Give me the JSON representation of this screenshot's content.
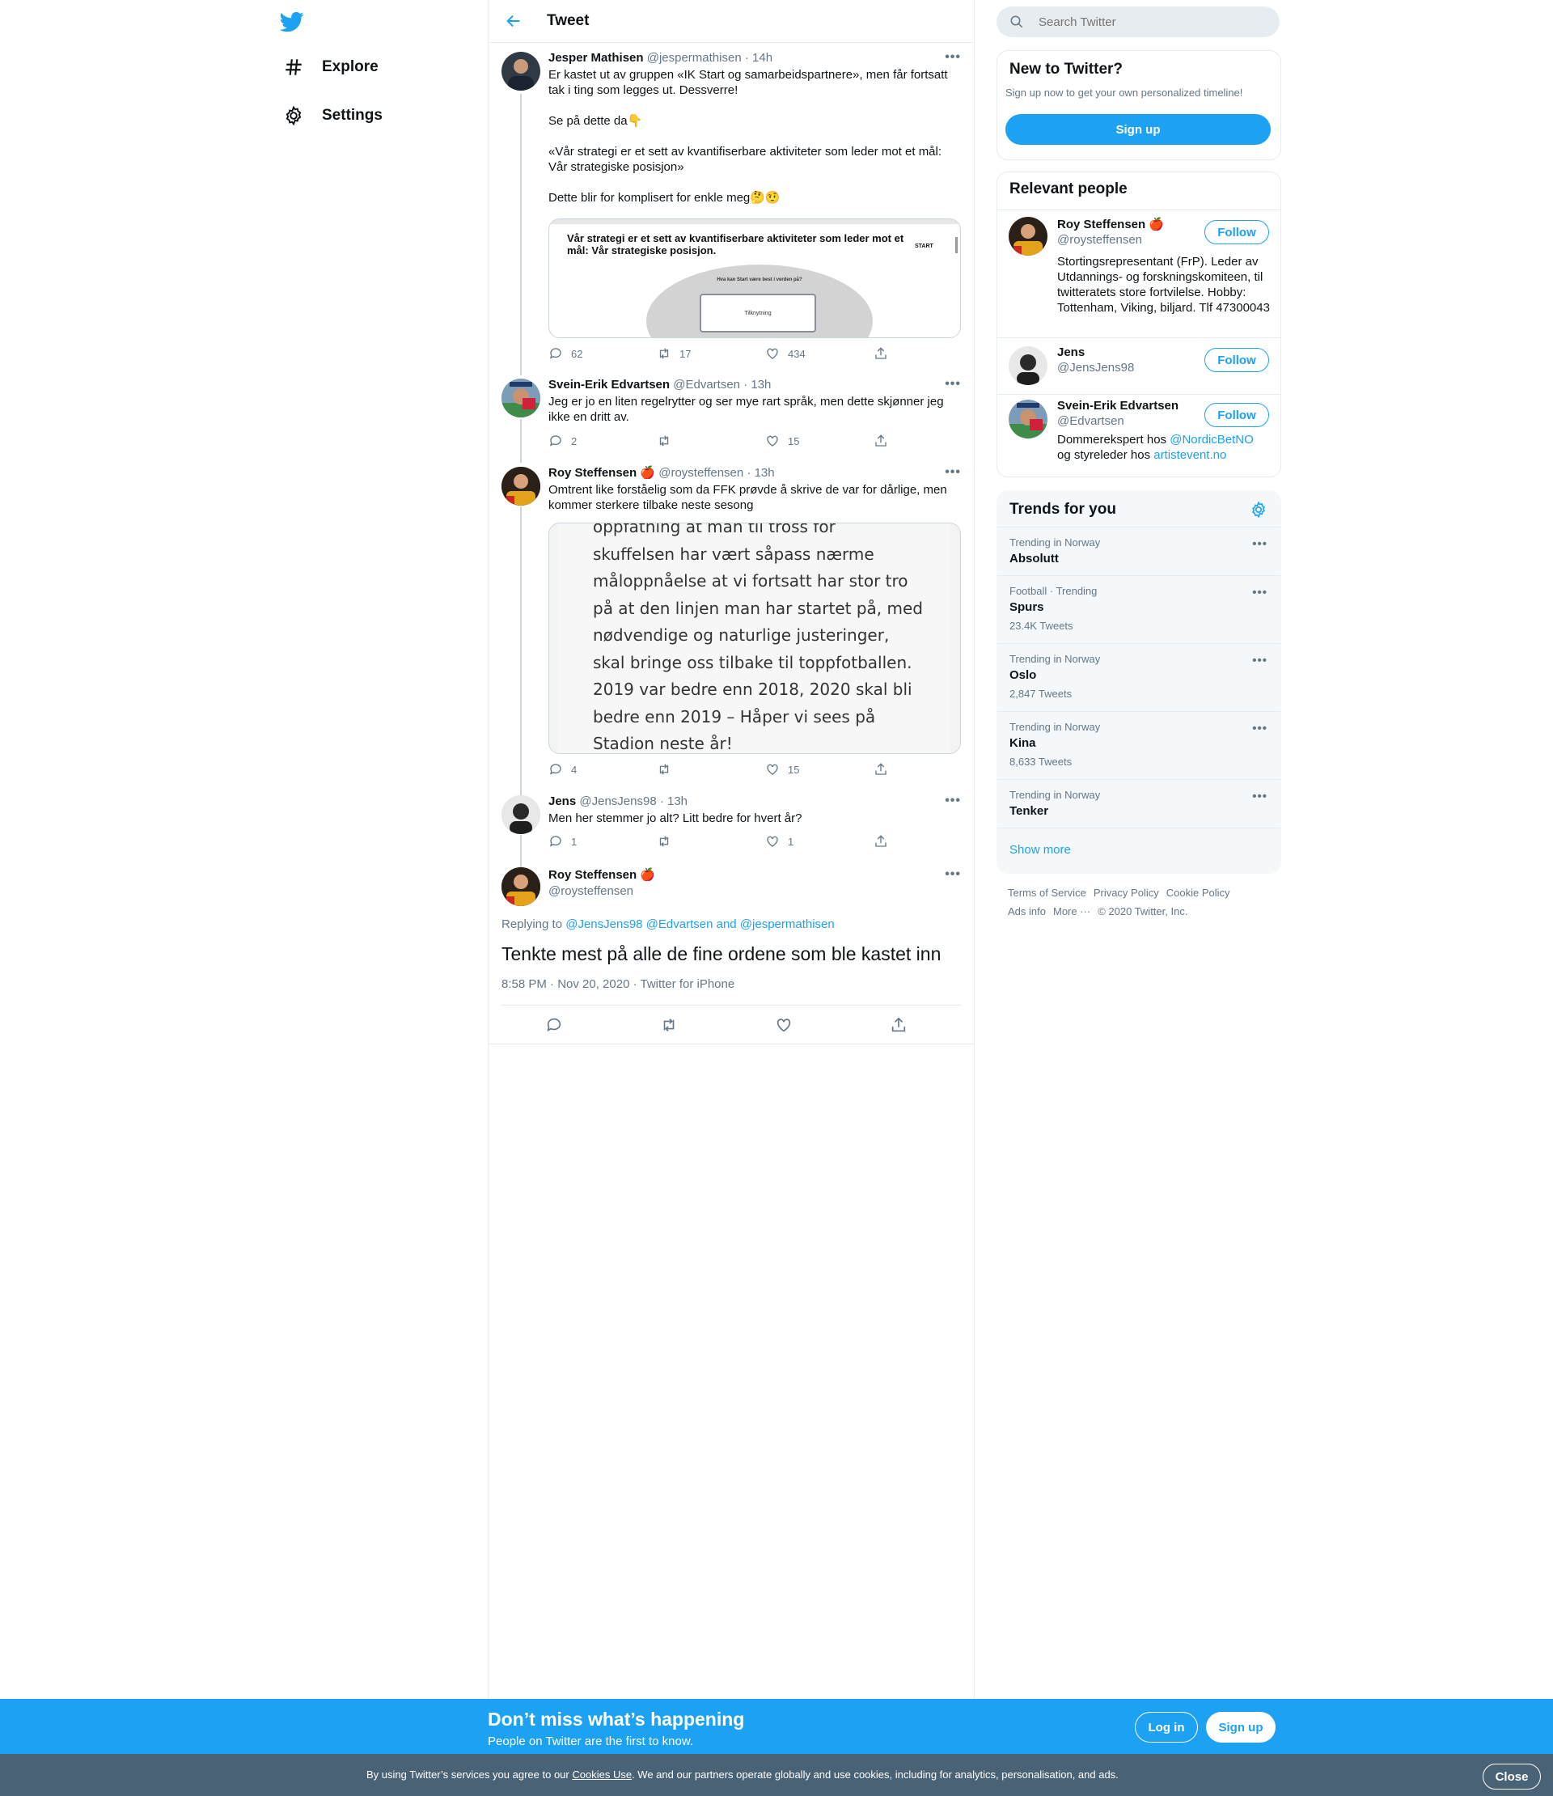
{
  "nav": {
    "logo": "twitter-bird-icon",
    "explore_label": "Explore",
    "settings_label": "Settings"
  },
  "header": {
    "title": "Tweet"
  },
  "tweets": [
    {
      "name": "Jesper Mathisen",
      "handle": "@jespermathisen",
      "time": "· 14h",
      "text": "Er kastet ut av gruppen «IK Start og samarbeidspartnere», men får fortsatt tak i ting som legges ut. Dessverre!\n\nSe på dette da👇\n\n«Vår strategi er et sett av kvantifiserbare aktiviteter som leder mot et mål: Vår strategiske posisjon»\n\nDette blir for komplisert for enkle meg🤔🤨",
      "media_title": "Vår strategi er et sett av kvantifiserbare aktiviteter som leder mot et mål: Vår strategiske posisjon.",
      "media_question": "Hva kan Start være best i verden på?",
      "media_box": "Tilknytning",
      "media_logo": "START",
      "replies": "62",
      "retweets": "17",
      "likes": "434"
    },
    {
      "name": "Svein-Erik Edvartsen",
      "handle": "@Edvartsen",
      "time": "· 13h",
      "text": "Jeg er jo en liten regelrytter og ser mye rart språk, men dette skjønner jeg ikke en dritt av.",
      "replies": "2",
      "retweets": "",
      "likes": "15"
    },
    {
      "name": "Roy Steffensen",
      "badge": "🍎",
      "handle": "@roysteffensen",
      "time": "· 13h",
      "text": "Omtrent like forståelig som da FFK prøvde å skrive de var for dårlige, men kommer sterkere tilbake neste sesong",
      "media_lines": [
        "oppfatning at man til tross for",
        "skuffelsen har vært såpass nærme",
        "måloppnåelse at vi fortsatt har stor tro",
        "på at den linjen man har startet på, med",
        "nødvendige og naturlige justeringer,",
        "skal bringe oss tilbake til toppfotballen.",
        "2019 var bedre enn 2018, 2020 skal bli",
        "bedre enn 2019 – Håper vi sees på",
        "Stadion neste år!"
      ],
      "replies": "4",
      "retweets": "",
      "likes": "15"
    },
    {
      "name": "Jens",
      "handle": "@JensJens98",
      "time": "· 13h",
      "text": "Men her stemmer jo alt? Litt bedre for hvert år?",
      "replies": "1",
      "retweets": "",
      "likes": "1"
    }
  ],
  "focus": {
    "name": "Roy Steffensen",
    "badge": "🍎",
    "handle": "@roysteffensen",
    "replying_prefix": "Replying to",
    "replying_to": "@JensJens98 @Edvartsen and @jespermathisen",
    "text": "Tenkte mest på alle de fine ordene som ble kastet inn",
    "meta": "8:58 PM · Nov 20, 2020 · Twitter for iPhone"
  },
  "search": {
    "placeholder": "Search Twitter"
  },
  "new_to_twitter": {
    "title": "New to Twitter?",
    "subtitle": "Sign up now to get your own personalized timeline!",
    "button": "Sign up"
  },
  "relevant": {
    "title": "Relevant people",
    "follow_label": "Follow",
    "people": [
      {
        "name": "Roy Steffensen",
        "badge": "🍎",
        "handle": "@roysteffensen",
        "bio": "Stortingsrepresentant (FrP). Leder av Utdannings- og forskningskomiteen, til twitteratets store fortvilelse. Hobby: Tottenham, Viking, biljard. Tlf 47300043"
      },
      {
        "name": "Jens",
        "handle": "@JensJens98",
        "bio": ""
      },
      {
        "name": "Svein-Erik Edvartsen",
        "handle": "@Edvartsen",
        "bio_prefix": "Dommerekspert hos",
        "bio_link1": "@NordicBetNO",
        "bio_mid": "og styreleder hos",
        "bio_link2": "artistevent.no"
      }
    ]
  },
  "trends": {
    "title": "Trends for you",
    "items": [
      {
        "category": "Trending in Norway",
        "name": "Absolutt",
        "count": ""
      },
      {
        "category": "Football · Trending",
        "name": "Spurs",
        "count": "23.4K Tweets"
      },
      {
        "category": "Trending in Norway",
        "name": "Oslo",
        "count": "2,847 Tweets"
      },
      {
        "category": "Trending in Norway",
        "name": "Kina",
        "count": "8,633 Tweets"
      },
      {
        "category": "Trending in Norway",
        "name": "Tenker",
        "count": ""
      }
    ],
    "show_more": "Show more"
  },
  "footer": {
    "terms": "Terms of Service",
    "privacy": "Privacy Policy",
    "cookie": "Cookie Policy",
    "ads": "Ads info",
    "more": "More ···",
    "copyright": "© 2020 Twitter, Inc."
  },
  "bottom_bar": {
    "title": "Don’t miss what’s happening",
    "subtitle": "People on Twitter are the first to know.",
    "login": "Log in",
    "signup": "Sign up"
  },
  "cookie_bar": {
    "text_before": "By using Twitter’s services you agree to our",
    "link": "Cookies Use",
    "text_after": ". We and our partners operate globally and use cookies, including for analytics, personalisation, and ads.",
    "close": "Close"
  },
  "colors": {
    "brand": "#1da1f2",
    "cookie_bar": "#4a6275",
    "muted": "#657786"
  }
}
